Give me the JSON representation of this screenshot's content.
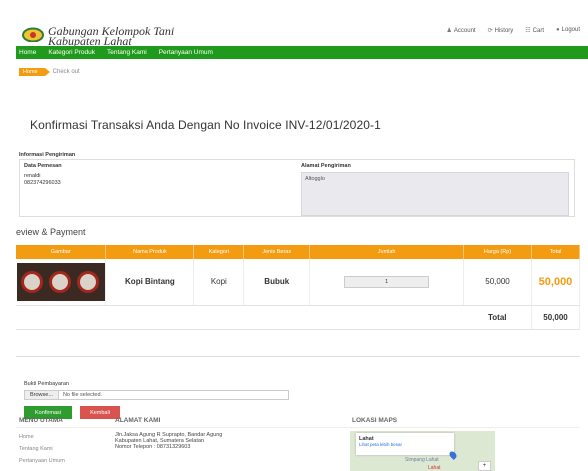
{
  "header": {
    "logo_line1": "Gabungan Kelompok Tani",
    "logo_line2": "Kabupaten Lahat",
    "links": [
      "Account",
      "History",
      "Cart",
      "Logout"
    ]
  },
  "nav": {
    "items": [
      "Home",
      "Kategori Produk",
      "Tentang Kami",
      "Pertanyaan Umum"
    ]
  },
  "breadcrumb": {
    "home": "Home",
    "current": "Check out"
  },
  "page_title": "Konfirmasi Transaksi Anda Dengan No Invoice INV-12/01/2020-1",
  "info": {
    "label": "Informasi Pengiriman",
    "pemesan_label": "Data Pemesan",
    "pemesan_name": "renaldi",
    "pemesan_phone": "082374296033",
    "alamat_label": "Alamat Pengiriman",
    "alamat_value": "Altogglo"
  },
  "review_heading": "eview & Payment",
  "table": {
    "headers": [
      "Gambar",
      "Nama Produk",
      "Kategori",
      "Jenis Beras",
      "Jumlah",
      "Harga (Rp)",
      "Total"
    ],
    "row": {
      "product": "Kopi Bintang",
      "category": "Kopi",
      "type": "Bubuk",
      "qty": "1",
      "price": "50,000",
      "total": "50,000"
    },
    "total_label": "Total",
    "total_value": "50,000"
  },
  "payment": {
    "bukti_label": "Bukti Pembayaran",
    "browse_label": "Browse...",
    "file_status": "No file selected.",
    "confirm_label": "Konfirmasi",
    "back_label": "Kembali"
  },
  "footer": {
    "menu_heading": "MENU UTAMA",
    "menu_items": [
      "Home",
      "Tentang Kami",
      "Pertanyaan Umum"
    ],
    "address_heading": "ALAMAT KAMI",
    "address_line1": "Jln.Jaksa Agung R Suprapto, Bandar Agung",
    "address_line2": "Kabupaten Lahat, Sumatera Selatan",
    "address_line3": "Nomor Telepon : 08731329603",
    "maps_heading": "LOKASI MAPS",
    "map_place": "Lahat",
    "map_link": "Lihat peta lebih besar",
    "map_road": "Simpang Lahat",
    "map_city": "Lahat",
    "map_zoom": "+"
  },
  "colors": {
    "nav_green": "#1f9a1c",
    "accent_orange": "#f39c12",
    "confirm_green": "#2e9c2e",
    "back_red": "#d9534f"
  }
}
